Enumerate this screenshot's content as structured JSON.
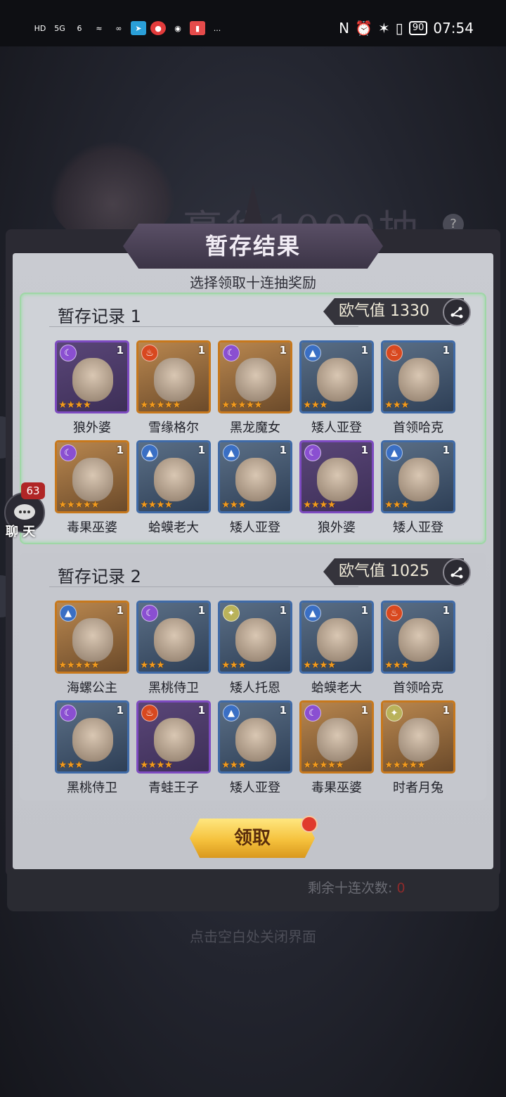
{
  "status_bar": {
    "left_labels": [
      "HD",
      "5G",
      "6",
      "..."
    ],
    "time": "07:54",
    "battery": "90"
  },
  "background_title": "豪华1000抽",
  "popup": {
    "title": "暂存结果",
    "subtitle": "选择领取十连抽奖励",
    "claim_label": "领取",
    "remaining_label": "剩余十连次数:",
    "remaining_value": "0",
    "close_hint": "点击空白处关闭界面"
  },
  "records": [
    {
      "title": "暂存记录 1",
      "luck_label": "欧气值",
      "luck_value": "1330",
      "heroes": [
        {
          "name": "狼外婆",
          "element": "moon",
          "frame": "purple",
          "level": "1",
          "stars": 4
        },
        {
          "name": "雪缘格尔",
          "element": "fire",
          "frame": "orange",
          "level": "1",
          "stars": 5
        },
        {
          "name": "黑龙魔女",
          "element": "moon",
          "frame": "orange",
          "level": "1",
          "stars": 5
        },
        {
          "name": "矮人亚登",
          "element": "water",
          "frame": "blue",
          "level": "1",
          "stars": 3
        },
        {
          "name": "首领哈克",
          "element": "fire",
          "frame": "blue",
          "level": "1",
          "stars": 3
        },
        {
          "name": "毒果巫婆",
          "element": "moon",
          "frame": "orange",
          "level": "1",
          "stars": 5
        },
        {
          "name": "蛤蟆老大",
          "element": "water",
          "frame": "blue",
          "level": "1",
          "stars": 4
        },
        {
          "name": "矮人亚登",
          "element": "water",
          "frame": "blue",
          "level": "1",
          "stars": 3
        },
        {
          "name": "狼外婆",
          "element": "moon",
          "frame": "purple",
          "level": "1",
          "stars": 4
        },
        {
          "name": "矮人亚登",
          "element": "water",
          "frame": "blue",
          "level": "1",
          "stars": 3
        }
      ]
    },
    {
      "title": "暂存记录 2",
      "luck_label": "欧气值",
      "luck_value": "1025",
      "heroes": [
        {
          "name": "海螺公主",
          "element": "water",
          "frame": "orange",
          "level": "1",
          "stars": 5
        },
        {
          "name": "黑桃侍卫",
          "element": "moon",
          "frame": "blue",
          "level": "1",
          "stars": 3
        },
        {
          "name": "矮人托恩",
          "element": "light",
          "frame": "blue",
          "level": "1",
          "stars": 3
        },
        {
          "name": "蛤蟆老大",
          "element": "water",
          "frame": "blue",
          "level": "1",
          "stars": 4
        },
        {
          "name": "首领哈克",
          "element": "fire",
          "frame": "blue",
          "level": "1",
          "stars": 3
        },
        {
          "name": "黑桃侍卫",
          "element": "moon",
          "frame": "blue",
          "level": "1",
          "stars": 3
        },
        {
          "name": "青蛙王子",
          "element": "fire",
          "frame": "purple",
          "level": "1",
          "stars": 4
        },
        {
          "name": "矮人亚登",
          "element": "water",
          "frame": "blue",
          "level": "1",
          "stars": 3
        },
        {
          "name": "毒果巫婆",
          "element": "moon",
          "frame": "orange",
          "level": "1",
          "stars": 5
        },
        {
          "name": "时者月兔",
          "element": "light",
          "frame": "orange",
          "level": "1",
          "stars": 5
        }
      ]
    }
  ],
  "chat": {
    "badge": "63",
    "label": "聊 天"
  },
  "colors": {
    "moon": "#8a4fd1",
    "fire": "#d8481f",
    "water": "#3a6fc4",
    "light": "#b9b25a"
  }
}
